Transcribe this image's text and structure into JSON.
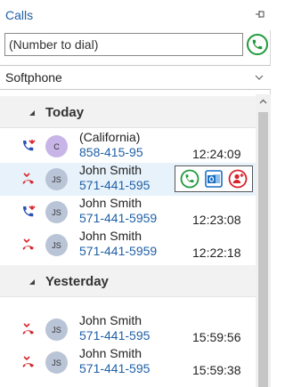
{
  "window": {
    "title": "Calls"
  },
  "dial": {
    "placeholder": "(Number to dial)"
  },
  "phone_select": {
    "selected": "Softphone"
  },
  "groups": [
    {
      "label": "Today"
    },
    {
      "label": "Yesterday"
    }
  ],
  "calls": [
    {
      "direction": "incoming",
      "initials": "C",
      "avatar_color": "#c8b4e6",
      "name": "(California)",
      "number": "858-415-95",
      "time": "12:24:09"
    },
    {
      "direction": "missed",
      "initials": "JS",
      "avatar_color": "#b9c4d6",
      "name": "John Smith",
      "number": "571-441-595",
      "time": ""
    },
    {
      "direction": "incoming",
      "initials": "JS",
      "avatar_color": "#b9c4d6",
      "name": "John Smith",
      "number": "571-441-5959",
      "time": "12:23:08"
    },
    {
      "direction": "missed",
      "initials": "JS",
      "avatar_color": "#b9c4d6",
      "name": "John Smith",
      "number": "571-441-5959",
      "time": "12:22:18"
    },
    {
      "direction": "missed",
      "initials": "JS",
      "avatar_color": "#b9c4d6",
      "name": "John Smith",
      "number": "571-441-595",
      "time": "15:59:56"
    },
    {
      "direction": "missed",
      "initials": "JS",
      "avatar_color": "#b9c4d6",
      "name": "John Smith",
      "number": "571-441-595",
      "time": "15:59:38"
    }
  ],
  "icons": {
    "pin": "pin-icon",
    "call": "phone-icon",
    "chevron": "chevron-down-icon",
    "incoming": "incoming-call-icon",
    "missed": "missed-call-icon",
    "outlook": "outlook-icon",
    "contact": "add-contact-icon"
  },
  "colors": {
    "accent": "#1f5fa5",
    "call_green": "#1f9a3a",
    "missed_red": "#d8232a",
    "incoming_blue": "#2a4fb3"
  }
}
